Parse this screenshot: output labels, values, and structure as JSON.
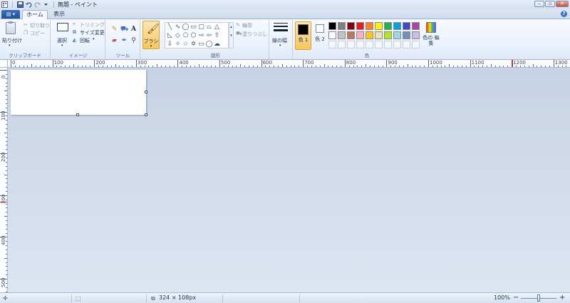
{
  "window": {
    "title": "無題 - ペイント"
  },
  "tabs": {
    "file": "▤ ▾",
    "home": "ホーム",
    "view": "表示",
    "help": "?"
  },
  "clipboard": {
    "paste": "貼り付け",
    "cut": "切り取り",
    "copy": "コピー",
    "group": "クリップボード"
  },
  "image": {
    "select": "選択",
    "crop": "トリミング",
    "resize": "サイズ変更",
    "rotate": "回転",
    "group": "イメージ"
  },
  "tools": {
    "group": "ツール",
    "brush": "ブラシ"
  },
  "shapes": {
    "outline": "輪郭",
    "fill": "塗りつぶし",
    "group": "図形"
  },
  "size": {
    "label": "線の幅"
  },
  "colors": {
    "color1": "色 1",
    "color2": "色 2",
    "edit": "色の 編集",
    "group": "色",
    "palette": [
      "#000000",
      "#7f7f7f",
      "#880015",
      "#ed1c24",
      "#ff7f27",
      "#fff200",
      "#22b14c",
      "#00a2e8",
      "#3f48cc",
      "#a349a4",
      "#ffffff",
      "#c3c3c3",
      "#b97a57",
      "#ffaec9",
      "#ffc90e",
      "#efe4b0",
      "#b5e61d",
      "#99d9ea",
      "#7092be",
      "#c8bfe7"
    ]
  },
  "rulers": {
    "h": [
      "0",
      "100",
      "200",
      "300",
      "400",
      "500",
      "600",
      "700",
      "800",
      "900",
      "1000",
      "1100",
      "1200",
      "1300"
    ],
    "v": [
      "0",
      "100",
      "200",
      "300",
      "400",
      "500"
    ]
  },
  "status": {
    "image_size": "324 × 108px",
    "zoom": "100%",
    "zoom_minus": "−",
    "zoom_plus": "+"
  }
}
